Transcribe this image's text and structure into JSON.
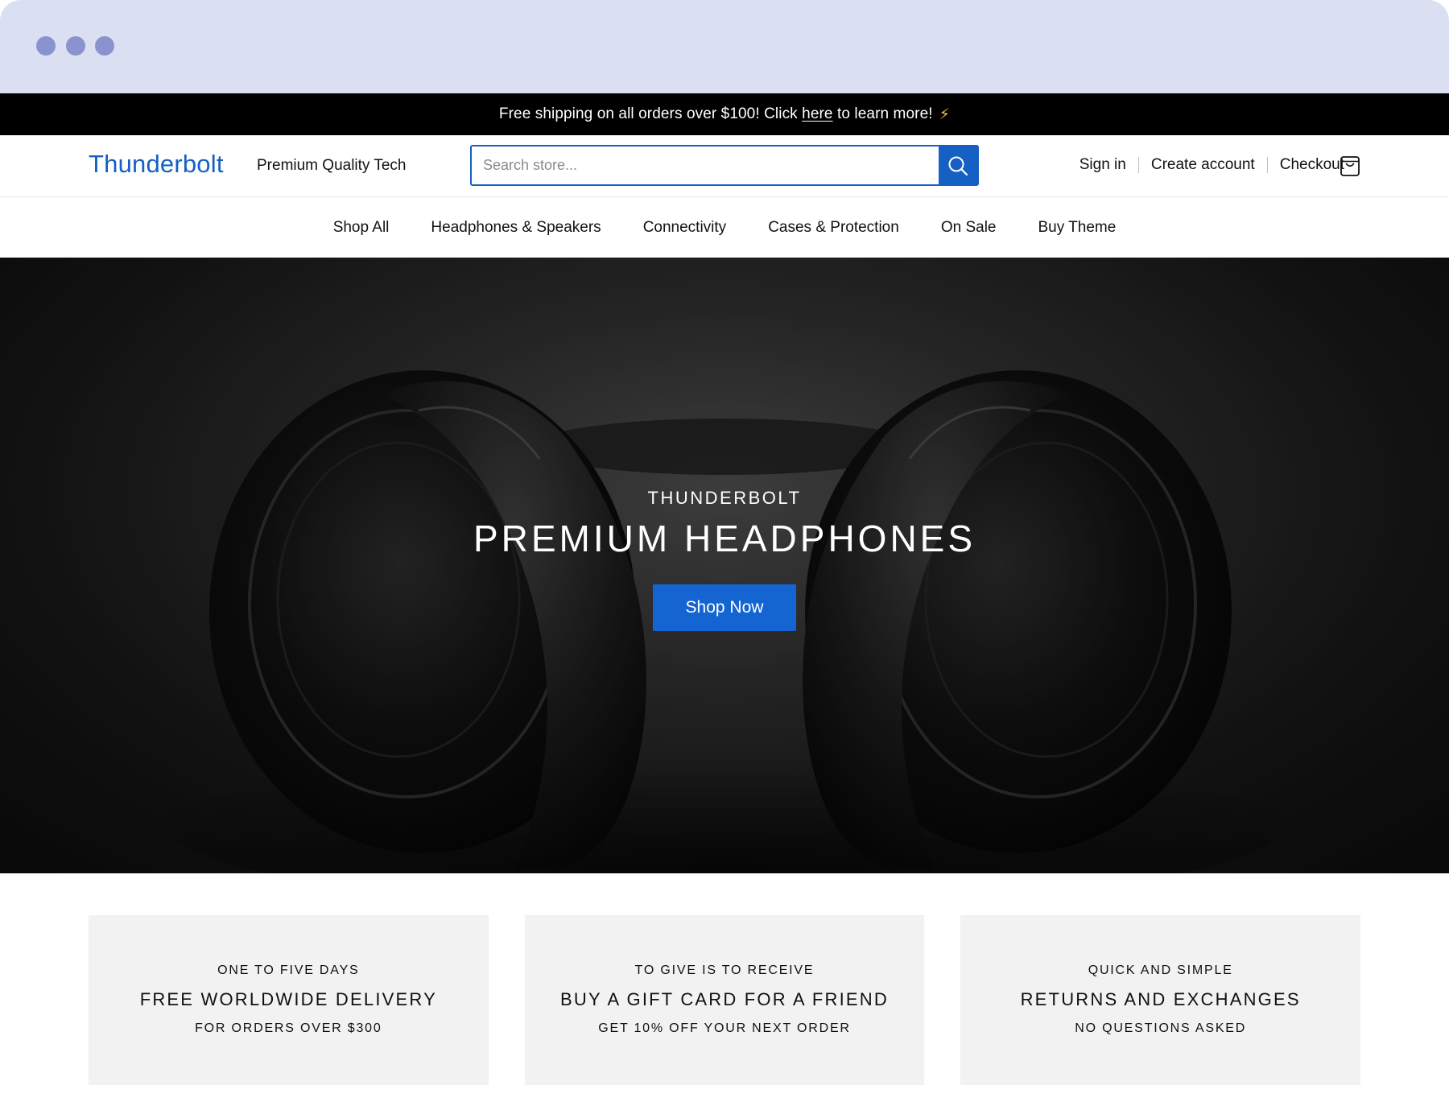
{
  "colors": {
    "brand": "#1560c2",
    "chrome": "#dadff2",
    "chrome_dots": "#8b93cf",
    "announce_bg": "#000000",
    "card_bg": "#f2f2f2"
  },
  "announcement": {
    "before": "Free shipping on all orders over $100! Click ",
    "link": "here",
    "after": " to learn more!",
    "icon": "lightning-bolt-icon"
  },
  "header": {
    "logo": "Thunderbolt",
    "tagline": "Premium Quality Tech",
    "search": {
      "placeholder": "Search store...",
      "value": "",
      "icon": "search-icon"
    },
    "account_links": [
      "Sign in",
      "Create account",
      "Checkout"
    ],
    "cart_icon": "shopping-bag-icon"
  },
  "nav": {
    "items": [
      "Shop All",
      "Headphones & Speakers",
      "Connectivity",
      "Cases & Protection",
      "On Sale",
      "Buy Theme"
    ]
  },
  "hero": {
    "eyebrow": "THUNDERBOLT",
    "title": "PREMIUM HEADPHONES",
    "button": "Shop Now"
  },
  "features": [
    {
      "eyebrow": "ONE TO FIVE DAYS",
      "title": "FREE WORLDWIDE DELIVERY",
      "sub": "FOR ORDERS OVER $300"
    },
    {
      "eyebrow": "TO GIVE IS TO RECEIVE",
      "title": "BUY A GIFT CARD FOR A FRIEND",
      "sub": "GET 10% OFF YOUR NEXT ORDER"
    },
    {
      "eyebrow": "QUICK AND SIMPLE",
      "title": "RETURNS AND EXCHANGES",
      "sub": "NO QUESTIONS ASKED"
    }
  ]
}
